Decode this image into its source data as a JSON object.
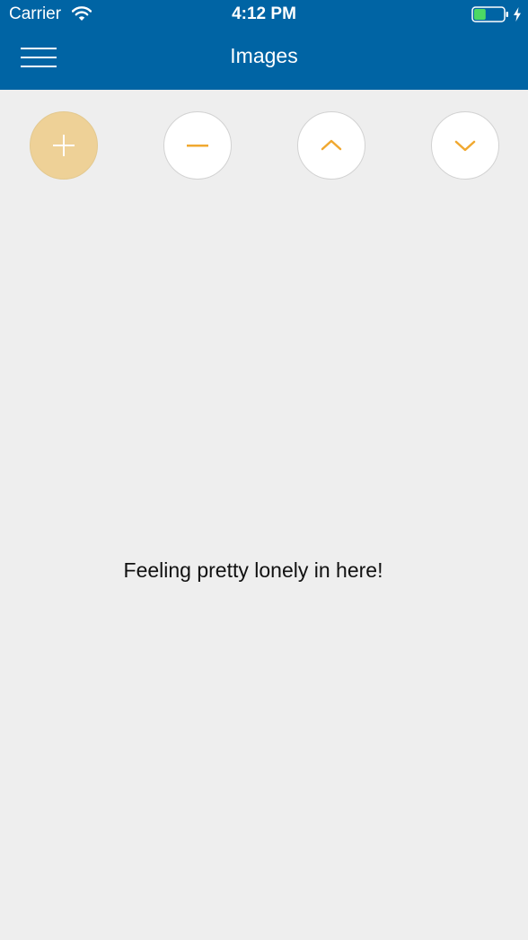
{
  "status_bar": {
    "carrier": "Carrier",
    "time": "4:12 PM",
    "wifi_icon": "wifi-icon",
    "battery_icon": "battery-icon",
    "charging_icon": "charging-bolt-icon",
    "battery_level": 0.4,
    "battery_color": "#4cd964"
  },
  "nav": {
    "title": "Images",
    "menu_icon": "hamburger-menu-icon",
    "background_color": "#0064a4"
  },
  "toolbar": {
    "buttons": [
      {
        "icon": "plus-icon",
        "color": "#eed197"
      },
      {
        "icon": "minus-icon",
        "color": "#ffffff"
      },
      {
        "icon": "chevron-up-icon",
        "color": "#ffffff"
      },
      {
        "icon": "chevron-down-icon",
        "color": "#ffffff"
      }
    ],
    "accent_color": "#f0a830"
  },
  "content": {
    "empty_message": "Feeling pretty lonely in here!"
  }
}
